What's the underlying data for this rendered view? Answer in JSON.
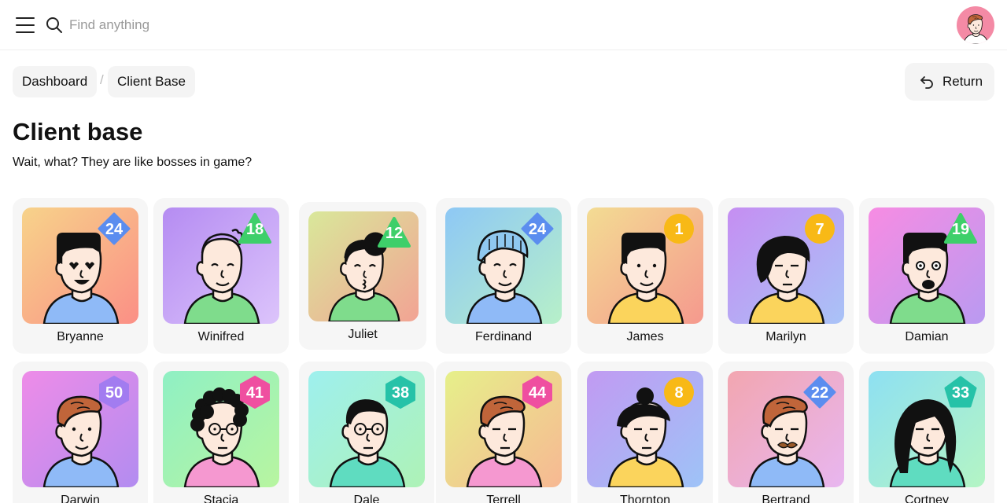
{
  "header": {
    "search_placeholder": "Find anything",
    "user_avatar": {
      "bg": "#f48aa5"
    }
  },
  "breadcrumb": {
    "items": [
      "Dashboard",
      "Client Base"
    ],
    "separator": "/"
  },
  "return_label": "Return",
  "page": {
    "title": "Client base",
    "subtitle": "Wait, what? They are like bosses in game?"
  },
  "clients": [
    {
      "name": "Bryanne",
      "level": "24",
      "badge": "diamond",
      "badge_color": "#5b8def",
      "bg": [
        "#f7d38a",
        "#fb8f86"
      ],
      "hair": "flat",
      "shirt": "#8fbaf7",
      "expression": "love"
    },
    {
      "name": "Winifred",
      "level": "18",
      "badge": "triangle",
      "badge_color": "#3ecf6a",
      "bg": [
        "#b58cf2",
        "#dcc4fb"
      ],
      "hair": "bald",
      "shirt": "#7fdc8c",
      "expression": "happy"
    },
    {
      "name": "Juliet",
      "level": "12",
      "badge": "triangle",
      "badge_color": "#3ecf6a",
      "bg": [
        "#d9e89a",
        "#f2a394"
      ],
      "hair": "puff",
      "shirt": "#7fdc8c",
      "expression": "kiss"
    },
    {
      "name": "Ferdinand",
      "level": "24",
      "badge": "diamond",
      "badge_color": "#5b8def",
      "bg": [
        "#8ec8f5",
        "#b7f0c9"
      ],
      "hair": "beanie",
      "shirt": "#8fbaf7",
      "expression": "happy"
    },
    {
      "name": "James",
      "level": "1",
      "badge": "circle",
      "badge_color": "#f8b916",
      "bg": [
        "#f3dc93",
        "#f5998e"
      ],
      "hair": "flat",
      "shirt": "#fbd45c",
      "expression": "calm"
    },
    {
      "name": "Marilyn",
      "level": "7",
      "badge": "circle",
      "badge_color": "#f8b916",
      "bg": [
        "#c58ef2",
        "#a9c3f7"
      ],
      "hair": "bob",
      "shirt": "#fbd45c",
      "expression": "meh"
    },
    {
      "name": "Damian",
      "level": "19",
      "badge": "triangle",
      "badge_color": "#3ecf6a",
      "bg": [
        "#f78ce3",
        "#b99af1"
      ],
      "hair": "flat",
      "shirt": "#7fdc8c",
      "expression": "shout"
    },
    {
      "name": "Darwin",
      "level": "50",
      "badge": "hexagon",
      "badge_color": "#a27cf0",
      "bg": [
        "#ee8ce8",
        "#b28cf0"
      ],
      "hair": "wavy",
      "shirt": "#8fbaf7",
      "expression": "calm"
    },
    {
      "name": "Stacia",
      "level": "41",
      "badge": "hexagon",
      "badge_color": "#ef4fa0",
      "bg": [
        "#8ff0c4",
        "#b8f5a0"
      ],
      "hair": "curly",
      "shirt": "#f598d0",
      "expression": "glasses"
    },
    {
      "name": "Dale",
      "level": "38",
      "badge": "hexagon",
      "badge_color": "#26c2a8",
      "bg": [
        "#9ef0ee",
        "#aef2b6"
      ],
      "hair": "short",
      "shirt": "#5fdcc0",
      "expression": "glasses"
    },
    {
      "name": "Terrell",
      "level": "44",
      "badge": "hexagon",
      "badge_color": "#ef4fa0",
      "bg": [
        "#e6f08a",
        "#f7b893"
      ],
      "hair": "wavy",
      "shirt": "#f598d0",
      "expression": "meh"
    },
    {
      "name": "Thornton",
      "level": "8",
      "badge": "circle",
      "badge_color": "#f8b916",
      "bg": [
        "#c19af2",
        "#9ec3f7"
      ],
      "hair": "bun",
      "shirt": "#fbd45c",
      "expression": "meh"
    },
    {
      "name": "Bertrand",
      "level": "22",
      "badge": "diamond",
      "badge_color": "#5b8def",
      "bg": [
        "#f2a6b0",
        "#e8b6f0"
      ],
      "hair": "wavy",
      "shirt": "#8fbaf7",
      "expression": "mustache"
    },
    {
      "name": "Cortney",
      "level": "33",
      "badge": "pentagon",
      "badge_color": "#26c2a8",
      "bg": [
        "#8ee0f2",
        "#b4f5c4"
      ],
      "hair": "long",
      "shirt": "#5fdcc0",
      "expression": "meh"
    }
  ]
}
